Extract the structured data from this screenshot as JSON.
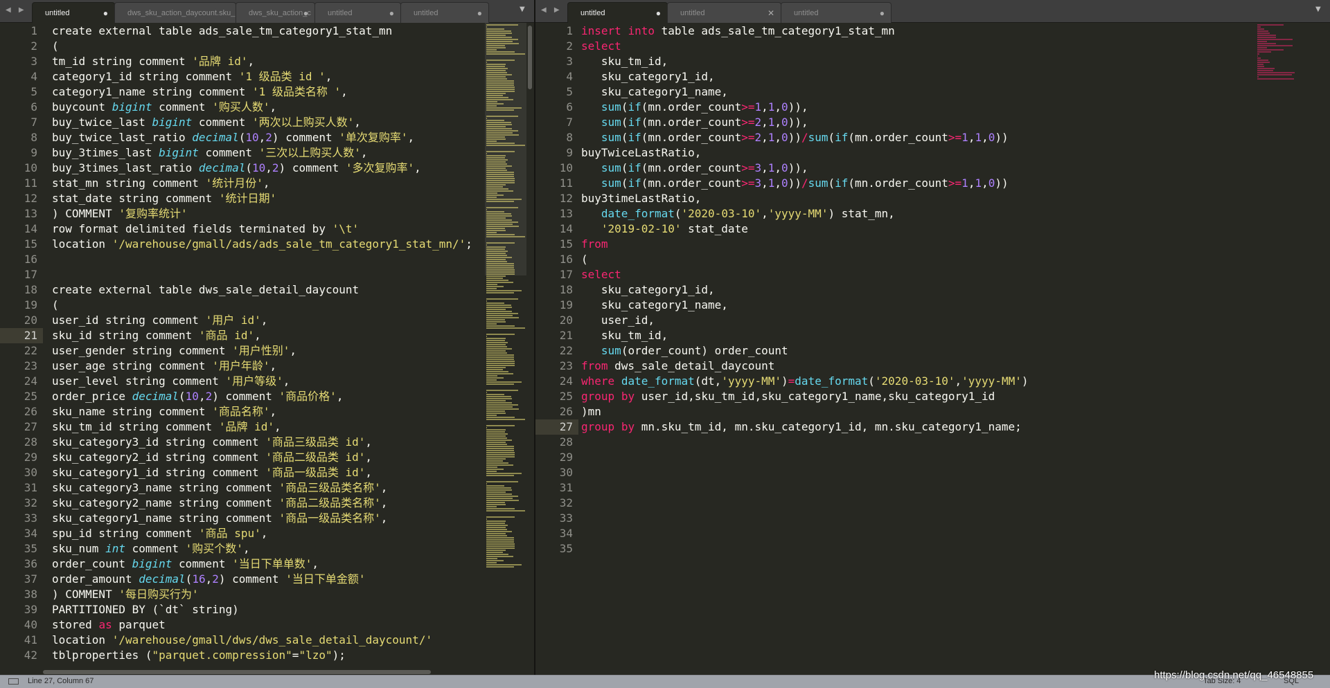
{
  "left_pane": {
    "nav_arrows": "◀ ▶",
    "tabs": [
      {
        "label": "untitled",
        "active": true,
        "close": "●"
      },
      {
        "label": "dws_sku_action_daycount.sku_id",
        "active": false,
        "close": ""
      },
      {
        "label": "dws_sku_action_c",
        "active": false,
        "close": "●"
      },
      {
        "label": "untitled",
        "active": false,
        "close": "●"
      },
      {
        "label": "untitled",
        "active": false,
        "close": "●"
      }
    ],
    "menu_glyph": "▼",
    "current_line": 21,
    "lines": [
      "create external table ads_sale_tm_category1_stat_mn",
      "(",
      "tm_id string comment '品牌 id',",
      "category1_id string comment '1 级品类 id ',",
      "category1_name string comment '1 级品类名称 ',",
      "buycount bigint comment '购买人数',",
      "buy_twice_last bigint comment '两次以上购买人数',",
      "buy_twice_last_ratio decimal(10,2) comment '单次复购率',",
      "buy_3times_last bigint comment '三次以上购买人数',",
      "buy_3times_last_ratio decimal(10,2) comment '多次复购率',",
      "stat_mn string comment '统计月份',",
      "stat_date string comment '统计日期'",
      ") COMMENT '复购率统计'",
      "row format delimited fields terminated by '\\t'",
      "location '/warehouse/gmall/ads/ads_sale_tm_category1_stat_mn/';",
      "",
      "",
      "create external table dws_sale_detail_daycount",
      "(",
      "user_id string comment '用户 id',",
      "sku_id string comment '商品 id',",
      "user_gender string comment '用户性别',",
      "user_age string comment '用户年龄',",
      "user_level string comment '用户等级',",
      "order_price decimal(10,2) comment '商品价格',",
      "sku_name string comment '商品名称',",
      "sku_tm_id string comment '品牌 id',",
      "sku_category3_id string comment '商品三级品类 id',",
      "sku_category2_id string comment '商品二级品类 id',",
      "sku_category1_id string comment '商品一级品类 id',",
      "sku_category3_name string comment '商品三级品类名称',",
      "sku_category2_name string comment '商品二级品类名称',",
      "sku_category1_name string comment '商品一级品类名称',",
      "spu_id string comment '商品 spu',",
      "sku_num int comment '购买个数',",
      "order_count bigint comment '当日下单单数',",
      "order_amount decimal(16,2) comment '当日下单金额'",
      ") COMMENT '每日购买行为'",
      "PARTITIONED BY (`dt` string)",
      "stored as parquet",
      "location '/warehouse/gmall/dws/dws_sale_detail_daycount/'",
      "tblproperties (\"parquet.compression\"=\"lzo\");"
    ]
  },
  "right_pane": {
    "nav_arrows": "◀ ▶",
    "tabs": [
      {
        "label": "untitled",
        "active": true,
        "close": "●"
      },
      {
        "label": "untitled",
        "active": false,
        "close": "✕"
      },
      {
        "label": "untitled",
        "active": false,
        "close": "●"
      }
    ],
    "menu_glyph": "▼",
    "current_line": 27,
    "line_count": 35,
    "lines": [
      "insert into table ads_sale_tm_category1_stat_mn",
      "select",
      "   sku_tm_id,",
      "   sku_category1_id,",
      "   sku_category1_name,",
      "   sum(if(mn.order_count>=1,1,0)),",
      "   sum(if(mn.order_count>=2,1,0)),",
      "   sum(if(mn.order_count>=2,1,0))/sum(if(mn.order_count>=1,1,0))",
      "buyTwiceLastRatio,",
      "   sum(if(mn.order_count>=3,1,0)),",
      "   sum(if(mn.order_count>=3,1,0))/sum(if(mn.order_count>=1,1,0))",
      "buy3timeLastRatio,",
      "   date_format('2020-03-10','yyyy-MM') stat_mn,",
      "   '2019-02-10' stat_date",
      "from",
      "(",
      "select",
      "   sku_category1_id,",
      "   sku_category1_name,",
      "   user_id,",
      "   sku_tm_id,",
      "   sum(order_count) order_count",
      "from dws_sale_detail_daycount",
      "where date_format(dt,'yyyy-MM')=date_format('2020-03-10','yyyy-MM')",
      "group by user_id,sku_tm_id,sku_category1_name,sku_category1_id",
      ")mn",
      "group by mn.sku_tm_id, mn.sku_category1_id, mn.sku_category1_name;"
    ]
  },
  "status_bar": {
    "position": "Line 27, Column 67",
    "tab_size": "Tab Size: 4",
    "syntax": "SQL"
  },
  "watermark": "https://blog.csdn.net/qq_46548855",
  "colors": {
    "background": "#272822",
    "keyword": "#f92672",
    "type": "#66d9ef",
    "string": "#e6db74",
    "number": "#ae81ff",
    "text": "#f8f8f2"
  }
}
